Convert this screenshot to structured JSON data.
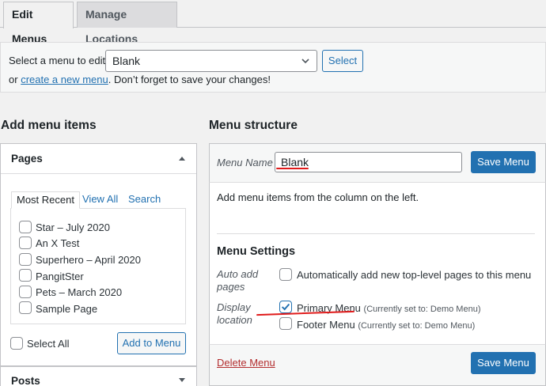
{
  "tabs": [
    {
      "label": "Edit Menus",
      "active": true
    },
    {
      "label": "Manage Locations",
      "active": false
    }
  ],
  "manage": {
    "select_label": "Select a menu to edit:",
    "selected_menu": "Blank",
    "select_button": "Select",
    "or_text": "or",
    "create_link": "create a new menu",
    "reminder": ". Don’t forget to save your changes!"
  },
  "add_items": {
    "heading": "Add menu items",
    "pages": {
      "title": "Pages",
      "tabs": [
        "Most Recent",
        "View All",
        "Search"
      ],
      "items": [
        "Star – July 2020",
        "An X Test",
        "Superhero – April 2020",
        "PangitSter",
        "Pets – March 2020",
        "Sample Page"
      ],
      "select_all": "Select All",
      "add_button": "Add to Menu"
    },
    "posts_title": "Posts"
  },
  "structure": {
    "heading": "Menu structure",
    "menu_name_label": "Menu Name",
    "menu_name_value": "Blank",
    "save_button": "Save Menu",
    "hint": "Add menu items from the column on the left.",
    "settings_heading": "Menu Settings",
    "auto_add_label": "Auto add pages",
    "auto_add_text": "Automatically add new top-level pages to this menu",
    "display_location_label": "Display location",
    "locations": [
      {
        "name": "Primary Menu",
        "note": "(Currently set to: Demo Menu)",
        "checked": true
      },
      {
        "name": "Footer Menu",
        "note": "(Currently set to: Demo Menu)",
        "checked": false
      }
    ],
    "delete_link": "Delete Menu",
    "save_button_bottom": "Save Menu"
  },
  "colors": {
    "accent": "#2271b1",
    "danger": "#b32d2e",
    "annotation": "#e01b1b"
  }
}
